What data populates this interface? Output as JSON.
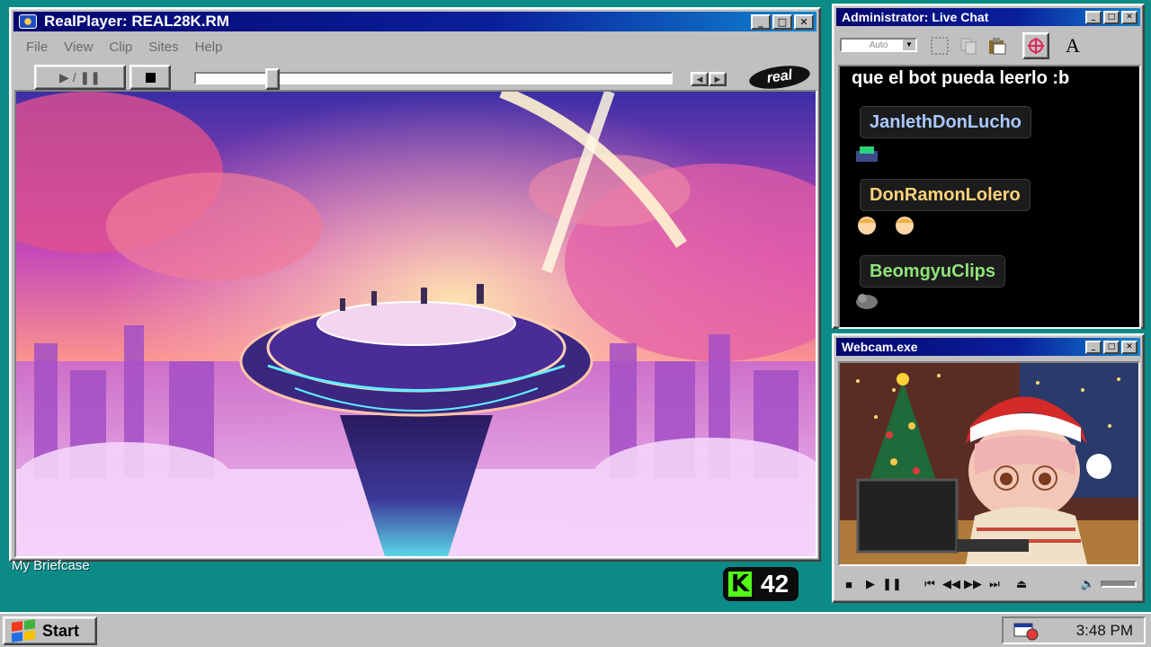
{
  "realplayer": {
    "title": "RealPlayer: REAL28K.RM",
    "menu": [
      "File",
      "View",
      "Clip",
      "Sites",
      "Help"
    ],
    "play_pause_label": "▶ / ❚❚",
    "logo_text": "real",
    "seek_progress": 0.15
  },
  "chat": {
    "title": "Administrator: Live Chat",
    "font_combo": "Auto",
    "first_line": "que el bot pueda leerlo :b",
    "messages": [
      {
        "user": "JanlethDonLucho",
        "color": "#a9c8ff"
      },
      {
        "user": "DonRamonLolero",
        "color": "#ffd27a"
      },
      {
        "user": "BeomgyuClips",
        "color": "#8fe37a"
      }
    ],
    "font_button": "A"
  },
  "webcam": {
    "title": "Webcam.exe"
  },
  "desktop": {
    "briefcase_label": "My Briefcase",
    "kick_letter": "K",
    "viewer_count": "42"
  },
  "taskbar": {
    "start_label": "Start",
    "clock": "3:48 PM"
  }
}
